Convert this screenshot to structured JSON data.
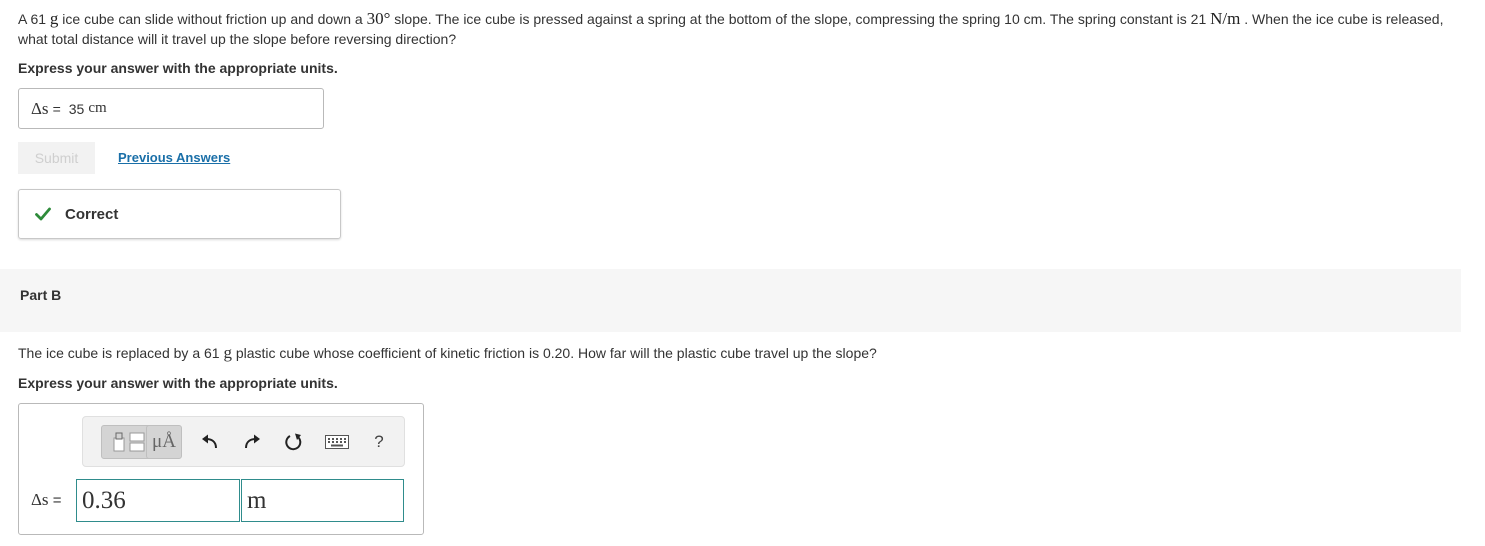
{
  "part_a": {
    "problem": {
      "t1": "A 61 ",
      "m1": "g",
      "t2": " ice cube can slide without friction up and down a ",
      "m2": "30°",
      "t3": " slope. The ice cube is pressed against a spring at the bottom of the slope, compressing the spring 10 cm. The spring constant is 21 ",
      "m3": "N/m",
      "t4": " . When the ice cube is released, what total distance will it travel up the slope before reversing direction?"
    },
    "express_label": "Express your answer with the appropriate units.",
    "answer": {
      "lhs": "Δs",
      "eq": "=",
      "value": "35",
      "unit": "cm"
    },
    "submit_label": "Submit",
    "previous_answers_label": "Previous Answers",
    "result_label": "Correct",
    "result_color": "#2e8b3a"
  },
  "part_b": {
    "title": "Part B",
    "problem": {
      "t1": "The ice cube is replaced by a 61 ",
      "m1": "g",
      "t2": " plastic cube whose coefficient of kinetic friction is 0.20. How far will the plastic cube travel up the slope?"
    },
    "express_label": "Express your answer with the appropriate units.",
    "toolbar": {
      "units_label": "μÅ",
      "help_label": "?",
      "icons": [
        "templates-icon",
        "units-icon",
        "undo-icon",
        "redo-icon",
        "reset-icon",
        "keyboard-icon",
        "help-icon"
      ]
    },
    "answer": {
      "lhs": "Δs",
      "eq": "=",
      "value": "0.36",
      "unit": "m"
    }
  }
}
